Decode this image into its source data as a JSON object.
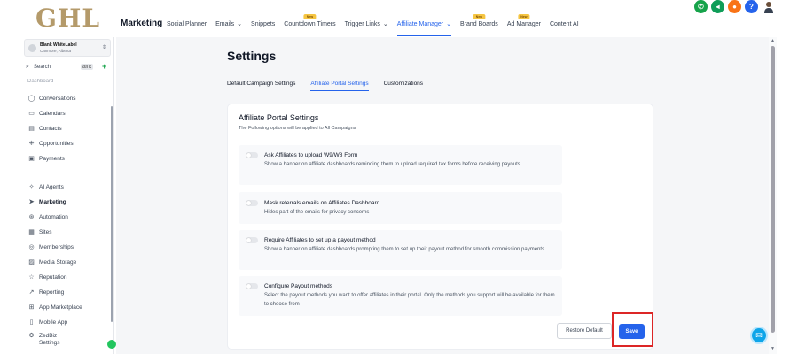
{
  "brand": {
    "logo_text": "GHL"
  },
  "header": {
    "app_title": "Marketing",
    "nav": [
      {
        "label": "Social Planner",
        "dropdown": false,
        "badge": ""
      },
      {
        "label": "Emails",
        "dropdown": true,
        "badge": ""
      },
      {
        "label": "Snippets",
        "dropdown": false,
        "badge": ""
      },
      {
        "label": "Countdown Timers",
        "dropdown": false,
        "badge": "New"
      },
      {
        "label": "Trigger Links",
        "dropdown": true,
        "badge": ""
      },
      {
        "label": "Affiliate Manager",
        "dropdown": true,
        "badge": "",
        "active": true
      },
      {
        "label": "Brand Boards",
        "dropdown": false,
        "badge": "New"
      },
      {
        "label": "Ad Manager",
        "dropdown": false,
        "badge": "New"
      },
      {
        "label": "Content AI",
        "dropdown": false,
        "badge": ""
      }
    ],
    "icons": [
      "phone-icon",
      "megaphone-icon",
      "bell-icon",
      "help-icon",
      "user-avatar-icon"
    ]
  },
  "sidebar": {
    "account": {
      "name": "Blank WhiteLabel",
      "location": "Canmore, Alberta"
    },
    "search": {
      "placeholder": "Search",
      "shortcut": "ctrl K"
    },
    "cut_item": "Dashboard",
    "items": [
      {
        "label": "Conversations",
        "icon": "chat-icon",
        "glyph": "◯"
      },
      {
        "label": "Calendars",
        "icon": "calendar-icon",
        "glyph": "▭"
      },
      {
        "label": "Contacts",
        "icon": "contacts-icon",
        "glyph": "▤"
      },
      {
        "label": "Opportunities",
        "icon": "opportunities-icon",
        "glyph": "⁜"
      },
      {
        "label": "Payments",
        "icon": "payments-icon",
        "glyph": "▣"
      },
      {
        "label": "AI Agents",
        "icon": "sparkle-icon",
        "glyph": "✧"
      },
      {
        "label": "Marketing",
        "icon": "send-icon",
        "glyph": "➤",
        "active": true
      },
      {
        "label": "Automation",
        "icon": "automation-icon",
        "glyph": "⊛"
      },
      {
        "label": "Sites",
        "icon": "sites-icon",
        "glyph": "▦"
      },
      {
        "label": "Memberships",
        "icon": "memberships-icon",
        "glyph": "◎"
      },
      {
        "label": "Media Storage",
        "icon": "media-icon",
        "glyph": "▨"
      },
      {
        "label": "Reputation",
        "icon": "star-icon",
        "glyph": "☆"
      },
      {
        "label": "Reporting",
        "icon": "reporting-icon",
        "glyph": "↗"
      },
      {
        "label": "App Marketplace",
        "icon": "apps-icon",
        "glyph": "⊞"
      },
      {
        "label": "Mobile App",
        "icon": "mobile-icon",
        "glyph": "▯"
      },
      {
        "label": "ZedBiz",
        "icon": "settings-icon",
        "glyph": "⚙"
      },
      {
        "label": "Settings",
        "icon": "",
        "glyph": ""
      }
    ]
  },
  "main": {
    "title": "Settings",
    "tabs": [
      {
        "label": "Default Campaign Settings",
        "active": false
      },
      {
        "label": "Affiliate Portal Settings",
        "active": true
      },
      {
        "label": "Customizations",
        "active": false
      }
    ],
    "card": {
      "title": "Affiliate Portal Settings",
      "subtitle": "The Following options will be applied to All Campaigns",
      "options": [
        {
          "title": "Ask Affiliates to upload W9/W8 Form",
          "description": "Show a banner on affiliate dashboards reminding them to upload required tax forms before receiving payouts.",
          "enabled": false
        },
        {
          "title": "Mask referrals emails on Affiliates Dashboard",
          "description": "Hides part of the emails for privacy concerns",
          "enabled": false
        },
        {
          "title": "Require Affiliates to set up a payout method",
          "description": "Show a banner on affiliate dashboards prompting them to set up their payout method for smooth commission payments.",
          "enabled": false
        },
        {
          "title": "Configure Payout methods",
          "description": "Select the payout methods you want to offer affiliates in their portal. Only the methods you support will be available for them to choose from",
          "enabled": false
        }
      ],
      "restore_label": "Restore Default",
      "save_label": "Save"
    }
  },
  "colors": {
    "accent": "#2563eb",
    "highlight": "#dc2626",
    "logo": "#b49a6a"
  }
}
